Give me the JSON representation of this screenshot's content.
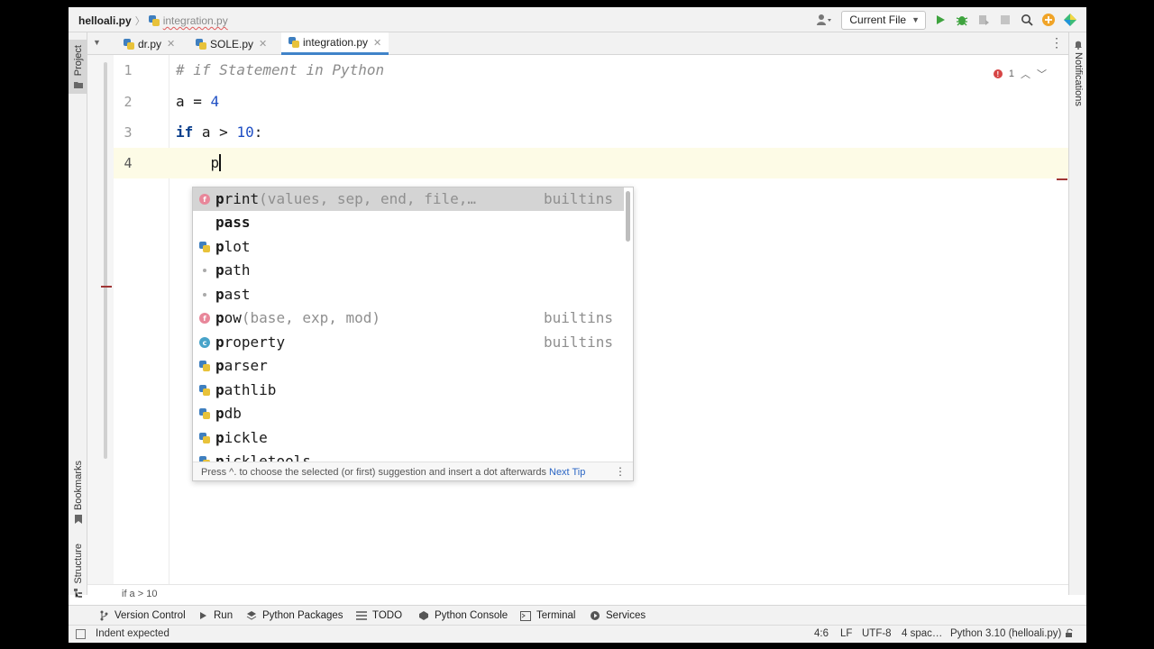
{
  "navbar": {
    "project": "helloali.py",
    "file": "integration.py",
    "run_config": "Current File"
  },
  "left_strip": {
    "project_tab": "Project",
    "bookmarks_tab": "Bookmarks",
    "structure_tab": "Structure"
  },
  "right_strip": {
    "notifications_tab": "Notifications"
  },
  "tabs": [
    {
      "label": "dr.py"
    },
    {
      "label": "SOLE.py"
    },
    {
      "label": "integration.py"
    }
  ],
  "editor": {
    "lines": [
      {
        "num": "1",
        "comment": "# if Statement in Python"
      },
      {
        "num": "2",
        "var": "a",
        "op": " = ",
        "value": "4"
      },
      {
        "num": "3",
        "kw": "if",
        "cond": " a > ",
        "value": "10",
        "colon": ":"
      },
      {
        "num": "4",
        "indent": "    ",
        "typed": "p"
      }
    ],
    "inspection_count": "1"
  },
  "completion": {
    "items": [
      {
        "match": "p",
        "rest": "rint",
        "tail": "(values, sep, end, file,…",
        "type": "builtins",
        "icon": "function-icon"
      },
      {
        "match": "p",
        "rest": "ass",
        "tail": "",
        "type": "",
        "icon": "none"
      },
      {
        "match": "p",
        "rest": "lot",
        "tail": "",
        "type": "",
        "icon": "python-package-icon"
      },
      {
        "match": "p",
        "rest": "ath",
        "tail": "",
        "type": "",
        "icon": "variable-dot-icon"
      },
      {
        "match": "p",
        "rest": "ast",
        "tail": "",
        "type": "",
        "icon": "variable-dot-icon"
      },
      {
        "match": "p",
        "rest": "ow",
        "tail": "(base, exp, mod)",
        "type": "builtins",
        "icon": "function-icon"
      },
      {
        "match": "p",
        "rest": "roperty",
        "tail": "",
        "type": "builtins",
        "icon": "class-icon"
      },
      {
        "match": "p",
        "rest": "arser",
        "tail": "",
        "type": "",
        "icon": "python-package-icon"
      },
      {
        "match": "p",
        "rest": "athlib",
        "tail": "",
        "type": "",
        "icon": "python-package-icon"
      },
      {
        "match": "p",
        "rest": "db",
        "tail": "",
        "type": "",
        "icon": "python-package-icon"
      },
      {
        "match": "p",
        "rest": "ickle",
        "tail": "",
        "type": "",
        "icon": "python-package-icon"
      },
      {
        "match": "p",
        "rest": "ickletools",
        "tail": "",
        "type": "",
        "icon": "python-package-icon"
      }
    ],
    "hint": "Press ^. to choose the selected (or first) suggestion and insert a dot afterwards",
    "next_tip": "Next Tip"
  },
  "code_breadcrumb": "if a > 10",
  "toolwindows": [
    {
      "label": "Version Control",
      "icon": "branch-icon"
    },
    {
      "label": "Run",
      "icon": "run-icon"
    },
    {
      "label": "Python Packages",
      "icon": "layers-icon"
    },
    {
      "label": "TODO",
      "icon": "list-icon"
    },
    {
      "label": "Python Console",
      "icon": "console-icon"
    },
    {
      "label": "Terminal",
      "icon": "terminal-icon"
    },
    {
      "label": "Services",
      "icon": "services-icon"
    }
  ],
  "status": {
    "message": "Indent expected",
    "position": "4:6",
    "line_sep": "LF",
    "encoding": "UTF-8",
    "indent": "4 spac…",
    "interpreter": "Python 3.10 (helloali.py)"
  },
  "colors": {
    "accent": "#4083c9",
    "current_line": "#fdfbe6",
    "keyword": "#0b3f8c",
    "number": "#1f4fc4",
    "error": "#d64545"
  }
}
